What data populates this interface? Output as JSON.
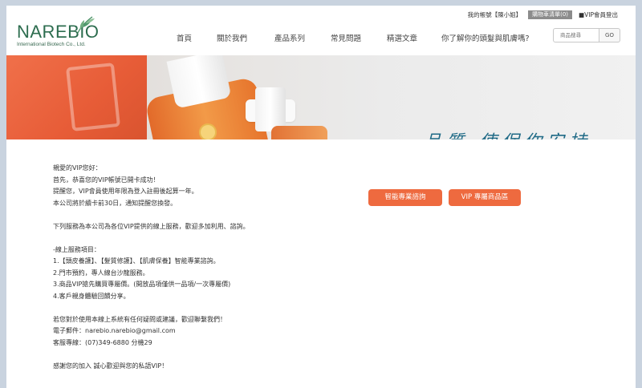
{
  "header": {
    "logo_word": "NAREBIO",
    "logo_sub": "International Biotech Co., Ltd.",
    "top_links": {
      "account": "我的帳號【陳小姐】",
      "cart": "購物車清單(0)",
      "logout": "■VIP會員登出"
    },
    "nav": [
      "首頁",
      "關於我們",
      "產品系列",
      "常見問題",
      "精選文章",
      "你了解你的頭髮與肌膚嗎?"
    ],
    "search": {
      "placeholder": "商品搜尋",
      "button": "GO"
    }
  },
  "banner": {
    "text": "品質  使保你安持"
  },
  "content": {
    "lines": [
      "親愛的VIP您好：",
      "首先，恭喜您的VIP帳號已開卡成功！",
      "提醒您，VIP會員使用年限為登入註冊後起算一年。",
      "本公司將於續卡前30日，通知提醒您換發。",
      "",
      "下列服務為本公司為各位VIP提供的線上服務，歡迎多加利用、諮詢。",
      "",
      "-線上服務項目：",
      "1.【頭皮養護】、【髮質修護】、【肌膚保養】智能專業諮詢。",
      "2.門市預約，專人線台沙龍服務。",
      "3.商品VIP搶先購買專屬價。(開放品項僅供一品項/一次專屬價)",
      "4.客戶親身體驗回饋分享。",
      "",
      "若您對於使用本線上系統有任何疑問或建議，歡迎聯繫我們！",
      "電子郵件：narebio.narebio@gmail.com",
      "客服專線：(07)349-6880 分機29",
      "",
      "感謝您的加入 誠心歡迎與您的私語VIP！"
    ]
  },
  "buttons": {
    "consult": "智能專業諮詢",
    "vip_products": "VIP 專屬商品區"
  },
  "colors": {
    "brand_green": "#2d6d4f",
    "accent_orange": "#ee6a3f",
    "banner_text": "#1f6a86"
  }
}
